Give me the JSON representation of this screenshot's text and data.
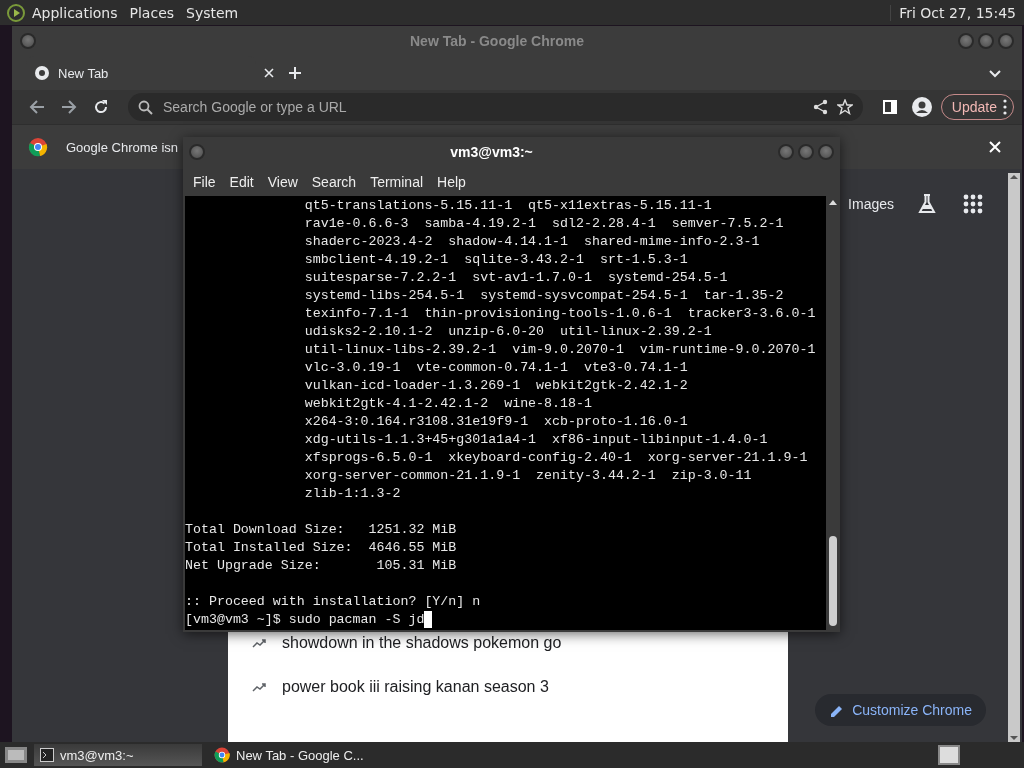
{
  "top_panel": {
    "menus": [
      "Applications",
      "Places",
      "System"
    ],
    "clock": "Fri Oct 27, 15:45"
  },
  "chrome": {
    "title": "New Tab - Google Chrome",
    "tabs": [
      {
        "label": "New Tab",
        "selected": true
      }
    ],
    "omnibox": {
      "placeholder": "Search Google or type a URL"
    },
    "update_button": "Update",
    "infobar": {
      "text": "Google Chrome isn"
    },
    "ntp": {
      "links": [
        "Images"
      ],
      "trending": [
        "showdown in the shadows pokemon go",
        "power book iii raising kanan season 3"
      ],
      "customize_button": "Customize Chrome"
    }
  },
  "terminal": {
    "title": "vm3@vm3:~",
    "menu": [
      "File",
      "Edit",
      "View",
      "Search",
      "Terminal",
      "Help"
    ],
    "blocks": [
      [
        "               qt5-translations-5.15.11-1  qt5-x11extras-5.15.11-1",
        "               rav1e-0.6.6-3  samba-4.19.2-1  sdl2-2.28.4-1  semver-7.5.2-1",
        "               shaderc-2023.4-2  shadow-4.14.1-1  shared-mime-info-2.3-1",
        "               smbclient-4.19.2-1  sqlite-3.43.2-1  srt-1.5.3-1",
        "               suitesparse-7.2.2-1  svt-av1-1.7.0-1  systemd-254.5-1",
        "               systemd-libs-254.5-1  systemd-sysvcompat-254.5-1  tar-1.35-2",
        "               texinfo-7.1-1  thin-provisioning-tools-1.0.6-1  tracker3-3.6.0-1",
        "               udisks2-2.10.1-2  unzip-6.0-20  util-linux-2.39.2-1",
        "               util-linux-libs-2.39.2-1  vim-9.0.2070-1  vim-runtime-9.0.2070-1",
        "               vlc-3.0.19-1  vte-common-0.74.1-1  vte3-0.74.1-1",
        "               vulkan-icd-loader-1.3.269-1  webkit2gtk-2.42.1-2",
        "               webkit2gtk-4.1-2.42.1-2  wine-8.18-1",
        "               x264-3:0.164.r3108.31e19f9-1  xcb-proto-1.16.0-1",
        "               xdg-utils-1.1.3+45+g301a1a4-1  xf86-input-libinput-1.4.0-1",
        "               xfsprogs-6.5.0-1  xkeyboard-config-2.40-1  xorg-server-21.1.9-1",
        "               xorg-server-common-21.1.9-1  zenity-3.44.2-1  zip-3.0-11",
        "               zlib-1:1.3-2"
      ],
      [
        "Total Download Size:   1251.32 MiB",
        "Total Installed Size:  4646.55 MiB",
        "Net Upgrade Size:       105.31 MiB"
      ],
      [
        ":: Proceed with installation? [Y/n] n",
        "[vm3@vm3 ~]$ sudo pacman -S jd"
      ]
    ],
    "cursor": true
  },
  "taskbar": {
    "tasks": [
      {
        "label": "vm3@vm3:~",
        "kind": "terminal",
        "selected": true
      },
      {
        "label": "New Tab - Google C...",
        "kind": "browser",
        "selected": false
      }
    ]
  }
}
